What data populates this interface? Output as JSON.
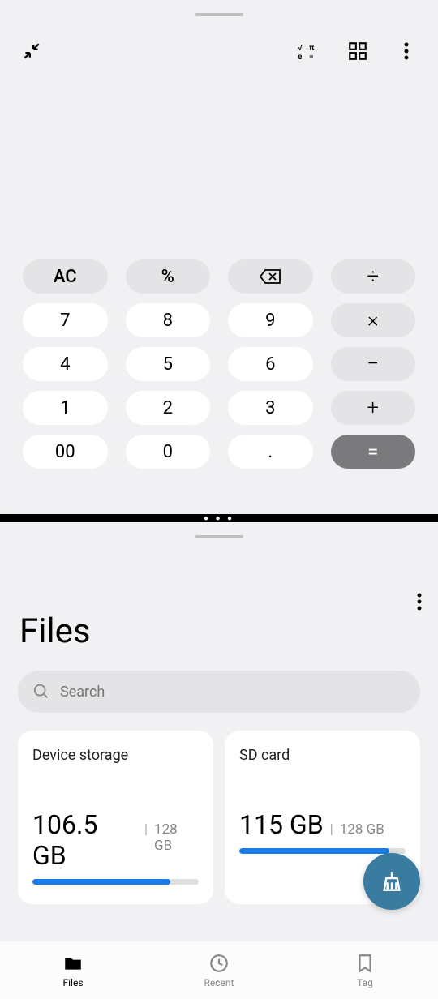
{
  "calculator": {
    "keys": {
      "ac": "AC",
      "percent": "%",
      "seven": "7",
      "eight": "8",
      "nine": "9",
      "four": "4",
      "five": "5",
      "six": "6",
      "one": "1",
      "two": "2",
      "three": "3",
      "doublezero": "00",
      "zero": "0",
      "decimal": ".",
      "divide": "÷",
      "multiply": "×",
      "minus": "−",
      "plus": "+",
      "equals": "="
    }
  },
  "files": {
    "title": "Files",
    "search_placeholder": "Search",
    "storage": {
      "device": {
        "label": "Device storage",
        "used": "106.5 GB",
        "divider": "|",
        "total": "128 GB",
        "percent": 83
      },
      "sd": {
        "label": "SD card",
        "used": "115 GB",
        "divider": "|",
        "total": "128 GB",
        "percent": 90
      }
    },
    "nav": {
      "files": "Files",
      "recent": "Recent",
      "tag": "Tag"
    }
  }
}
